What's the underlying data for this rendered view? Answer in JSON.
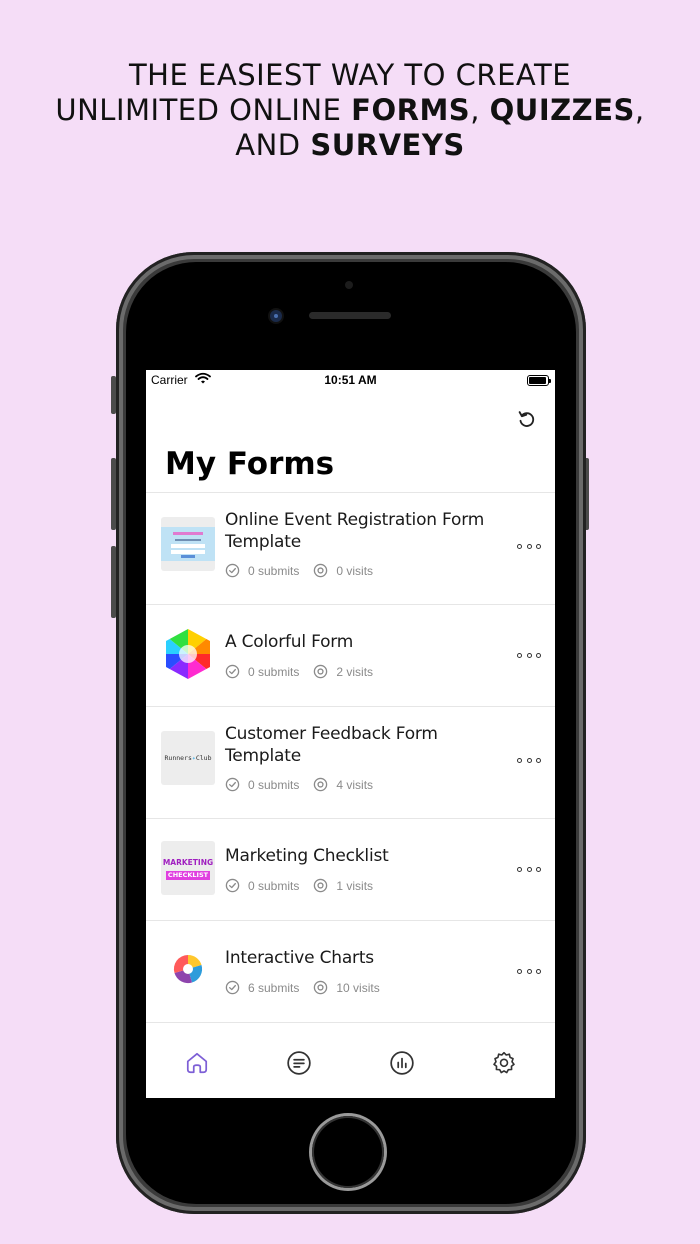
{
  "headline": {
    "line1": "THE EASIEST WAY TO CREATE",
    "line2_pre": "UNLIMITED ONLINE ",
    "line2_bold1": "FORMS",
    "line2_sep": ", ",
    "line2_bold2": "QUIZZES",
    "line2_post": ",",
    "line3_pre": "AND ",
    "line3_bold": "SURVEYS"
  },
  "status_bar": {
    "carrier": "Carrier",
    "time": "10:51 AM"
  },
  "screen": {
    "title": "My Forms",
    "refresh_icon": "refresh-icon"
  },
  "forms": [
    {
      "title": "Online Event Registration Form Template",
      "submits": "0 submits",
      "visits": "0 visits",
      "thumb": "event-registration-thumbnail"
    },
    {
      "title": "A Colorful Form",
      "submits": "0 submits",
      "visits": "2 visits",
      "thumb": "color-hexagon-thumbnail"
    },
    {
      "title": "Customer Feedback Form Template",
      "submits": "0 submits",
      "visits": "4 visits",
      "thumb": "runners-club-thumbnail",
      "thumb_text_left": "Runners",
      "thumb_text_right": "Club"
    },
    {
      "title": "Marketing Checklist",
      "submits": "0 submits",
      "visits": "1 visits",
      "thumb": "marketing-checklist-thumbnail",
      "thumb_text_top": "MARKETING",
      "thumb_text_bottom": "CHECKLIST"
    },
    {
      "title": "Interactive Charts",
      "submits": "6 submits",
      "visits": "10 visits",
      "thumb": "pie-chart-thumbnail"
    }
  ],
  "tabbar": [
    {
      "icon": "home-icon",
      "active": true
    },
    {
      "icon": "forms-list-icon",
      "active": false
    },
    {
      "icon": "analytics-icon",
      "active": false
    },
    {
      "icon": "settings-icon",
      "active": false
    }
  ],
  "colors": {
    "background": "#f5ddf7",
    "accent": "#7d5fd6",
    "muted": "#8a8a8a"
  }
}
